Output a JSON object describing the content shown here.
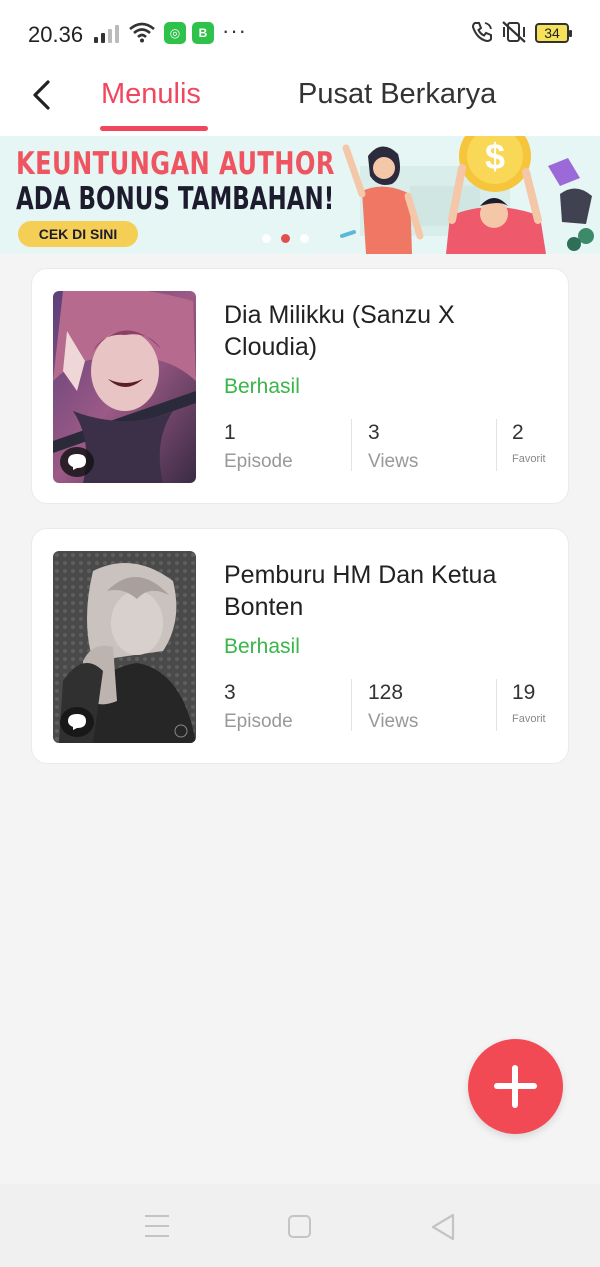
{
  "status_bar": {
    "time": "20.36",
    "battery": "34",
    "more": "···"
  },
  "header": {
    "tabs": [
      {
        "label": "Menulis",
        "active": true
      },
      {
        "label": "Pusat Berkarya",
        "active": false
      }
    ]
  },
  "banner": {
    "line1": "KEUNTUNGAN AUTHOR",
    "line2": "ADA BONUS TAMBAHAN!",
    "cta": "CEK DI SINI",
    "slides": 3,
    "active_slide": 2
  },
  "stories": [
    {
      "title": "Dia Milikku (Sanzu X Cloudia)",
      "status": "Berhasil",
      "episodes": "1",
      "episode_label": "Episode",
      "views": "3",
      "views_label": "Views",
      "favorites": "2",
      "favorite_label": "Favorit"
    },
    {
      "title": "Pemburu HM Dan Ketua Bonten",
      "status": "Berhasil",
      "episodes": "3",
      "episode_label": "Episode",
      "views": "128",
      "views_label": "Views",
      "favorites": "19",
      "favorite_label": "Favorit"
    }
  ],
  "colors": {
    "accent": "#f0475e",
    "status_success": "#39b54a",
    "fab": "#f24a55"
  },
  "icons": {
    "back": "chevron-left-icon",
    "comment": "comment-icon",
    "add": "plus-icon",
    "nav_menu": "menu-icon",
    "nav_home": "home-icon",
    "nav_back": "triangle-back-icon"
  }
}
